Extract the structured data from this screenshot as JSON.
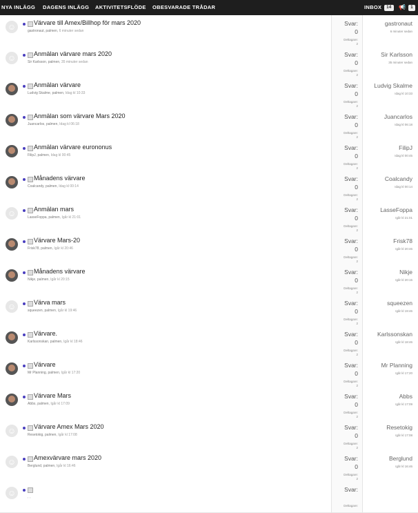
{
  "nav": {
    "items": [
      "NYA INLÄGG",
      "DAGENS INLÄGG",
      "AKTIVITETSFLÖDE",
      "OBESVARADE TRÅDAR"
    ],
    "inbox_label": "INBOX",
    "inbox_count": "14",
    "alerts_count": "1"
  },
  "labels": {
    "replies": "Svar:",
    "participants": "Deltagare:"
  },
  "threads": [
    {
      "title": "Värvare till Amex/Billhop för mars 2020",
      "author": "gastronaut",
      "forum": "palmen",
      "time": "6 minuter sedan",
      "replies": "0",
      "participants": "2",
      "last_user": "gastronaut",
      "last_time": "6 minuter sedan",
      "avatar": "default"
    },
    {
      "title": "Anmälan värvare mars 2020",
      "author": "Sir Karlsson",
      "forum": "palmen",
      "time": "35 minuter sedan",
      "replies": "0",
      "participants": "2",
      "last_user": "Sir Karlsson",
      "last_time": "35 minuter sedan",
      "avatar": "default"
    },
    {
      "title": "Anmälan värvare",
      "author": "Ludvig Skalme",
      "forum": "palmen",
      "time": "Idag kl 10:33",
      "replies": "0",
      "participants": "2",
      "last_user": "Ludvig Skalme",
      "last_time": "Idag kl 10:33",
      "avatar": "photo"
    },
    {
      "title": "Anmälan som värvare Mars 2020",
      "author": "Juancarlos",
      "forum": "palmen",
      "time": "Idag kl 06:18",
      "replies": "0",
      "participants": "2",
      "last_user": "Juancarlos",
      "last_time": "Idag kl 06:18",
      "avatar": "photo"
    },
    {
      "title": "Anmälan värvare eurononus",
      "author": "FilipJ",
      "forum": "palmen",
      "time": "Idag kl 00:45",
      "replies": "0",
      "participants": "2",
      "last_user": "FilipJ",
      "last_time": "Idag kl 00:45",
      "avatar": "photo"
    },
    {
      "title": "Månadens värvare",
      "author": "Coalcandy",
      "forum": "palmen",
      "time": "Idag kl 00:14",
      "replies": "0",
      "participants": "2",
      "last_user": "Coalcandy",
      "last_time": "Idag kl 00:14",
      "avatar": "photo"
    },
    {
      "title": "Anmälan mars",
      "author": "LasseFoppa",
      "forum": "palmen",
      "time": "Igår kl 21:01",
      "replies": "0",
      "participants": "2",
      "last_user": "LasseFoppa",
      "last_time": "Igår kl 21:01",
      "avatar": "default"
    },
    {
      "title": "Värvare Mars-20",
      "author": "Frisk78",
      "forum": "palmen",
      "time": "Igår kl 20:46",
      "replies": "0",
      "participants": "2",
      "last_user": "Frisk78",
      "last_time": "Igår kl 20:46",
      "avatar": "photo"
    },
    {
      "title": "Månadens värvare",
      "author": "Nikje",
      "forum": "palmen",
      "time": "Igår kl 20:15",
      "replies": "0",
      "participants": "2",
      "last_user": "Nikje",
      "last_time": "Igår kl 20:15",
      "avatar": "photo"
    },
    {
      "title": "Värva mars",
      "author": "squeezen",
      "forum": "palmen",
      "time": "Igår kl 19:46",
      "replies": "0",
      "participants": "2",
      "last_user": "squeezen",
      "last_time": "Igår kl 19:46",
      "avatar": "default"
    },
    {
      "title": "Värvare.",
      "author": "Karlssonskan",
      "forum": "palmen",
      "time": "Igår kl 18:46",
      "replies": "0",
      "participants": "2",
      "last_user": "Karlssonskan",
      "last_time": "Igår kl 18:46",
      "avatar": "photo"
    },
    {
      "title": "Värvare",
      "author": "Mr Planning",
      "forum": "palmen",
      "time": "Igår kl 17:20",
      "replies": "0",
      "participants": "2",
      "last_user": "Mr Planning",
      "last_time": "Igår kl 17:20",
      "avatar": "photo"
    },
    {
      "title": "Värvare Mars",
      "author": "Abbs",
      "forum": "palmen",
      "time": "Igår kl 17:09",
      "replies": "0",
      "participants": "2",
      "last_user": "Abbs",
      "last_time": "Igår kl 17:09",
      "avatar": "photo"
    },
    {
      "title": "Värvare Amex Mars 2020",
      "author": "Resetokig",
      "forum": "palmen",
      "time": "Igår kl 17:08",
      "replies": "0",
      "participants": "2",
      "last_user": "Resetokig",
      "last_time": "Igår kl 17:08",
      "avatar": "default"
    },
    {
      "title": "Amexvärvare mars 2020",
      "author": "Berglund",
      "forum": "palmen",
      "time": "Igår kl 16:46",
      "replies": "0",
      "participants": "2",
      "last_user": "Berglund",
      "last_time": "Igår kl 16:46",
      "avatar": "default"
    },
    {
      "title": "",
      "author": "",
      "forum": "",
      "time": "",
      "replies": "",
      "participants": "",
      "last_user": "",
      "last_time": "",
      "avatar": "default"
    }
  ]
}
